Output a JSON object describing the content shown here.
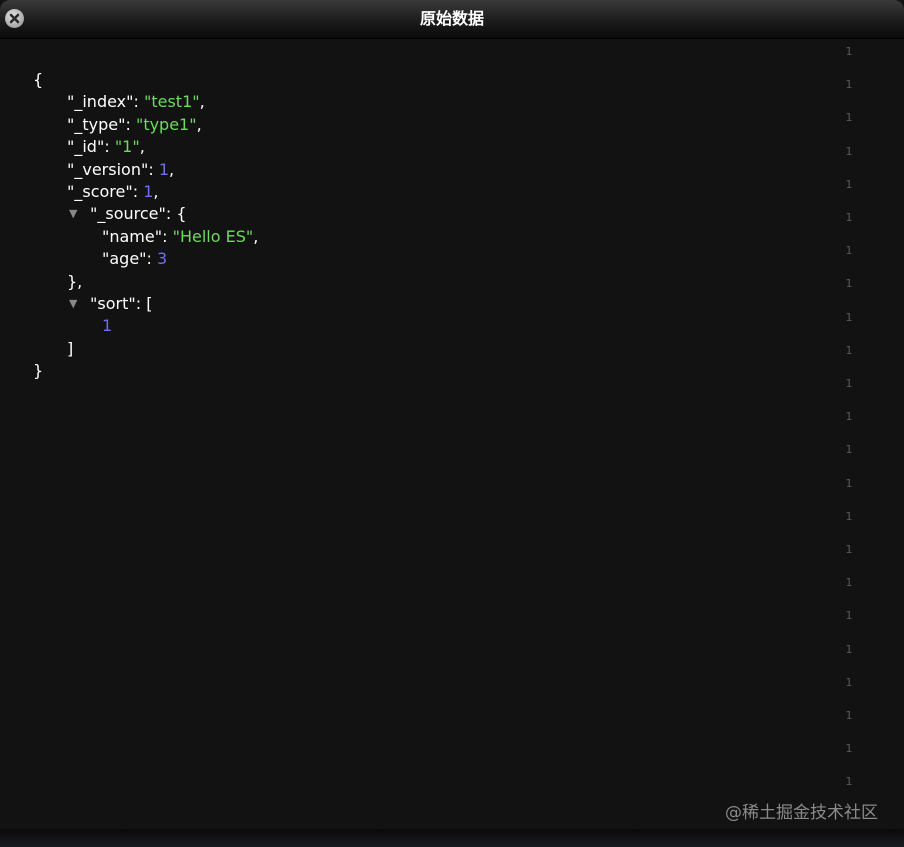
{
  "window": {
    "title": "原始数据"
  },
  "json": {
    "open_brace": "{",
    "close_brace": "}",
    "fields": [
      {
        "key": "\"_index\"",
        "value": "\"test1\"",
        "comma": ","
      },
      {
        "key": "\"_type\"",
        "value": "\"type1\"",
        "comma": ","
      },
      {
        "key": "\"_id\"",
        "value": "\"1\"",
        "comma": ","
      },
      {
        "key": "\"_version\"",
        "value": "1",
        "comma": ","
      },
      {
        "key": "\"_score\"",
        "value": "1",
        "comma": ","
      }
    ],
    "source": {
      "key": "\"_source\"",
      "open": "{",
      "close": "},",
      "fields": [
        {
          "key": "\"name\"",
          "value": "\"Hello ES\"",
          "comma": ","
        },
        {
          "key": "\"age\"",
          "value": "3",
          "comma": ""
        }
      ]
    },
    "sort": {
      "key": "\"sort\"",
      "open": "[",
      "close": "]",
      "values": [
        "1"
      ]
    },
    "colon": ": ",
    "toggle_glyph": "▼"
  },
  "gutter_marker": "1",
  "watermark": "@稀土掘金技术社区",
  "colors": {
    "string": "#6bdc5b",
    "number": "#6f6ff0",
    "key": "#ffffff",
    "background": "#121212"
  },
  "icons": {
    "close": "close-icon",
    "collapse": "triangle-down-icon"
  }
}
